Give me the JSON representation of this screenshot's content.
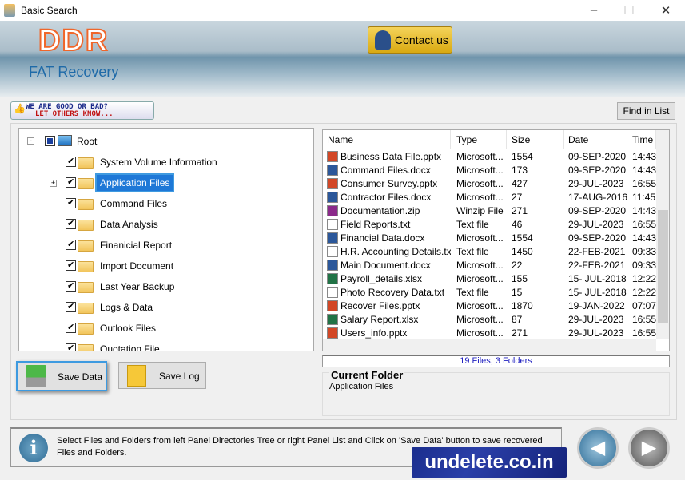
{
  "window": {
    "title": "Basic Search"
  },
  "banner": {
    "logo": "DDR",
    "product": "FAT Recovery",
    "contact_label": "Contact us"
  },
  "rating": {
    "line1": "WE ARE GOOD OR BAD?",
    "line2": "LET OTHERS KNOW..."
  },
  "find_label": "Find in List",
  "tree": {
    "root": "Root",
    "items": [
      {
        "label": "System Volume Information"
      },
      {
        "label": "Application Files",
        "selected": true,
        "expandable": true
      },
      {
        "label": "Command Files"
      },
      {
        "label": "Data Analysis"
      },
      {
        "label": "Finanicial Report"
      },
      {
        "label": "Import Document"
      },
      {
        "label": "Last Year Backup"
      },
      {
        "label": "Logs & Data"
      },
      {
        "label": "Outlook Files"
      },
      {
        "label": "Quotation File"
      }
    ]
  },
  "list": {
    "columns": [
      "Name",
      "Type",
      "Size",
      "Date",
      "Time"
    ],
    "rows": [
      {
        "icon": "pptx",
        "name": "Business Data File.pptx",
        "type": "Microsoft...",
        "size": "1554",
        "date": "09-SEP-2020",
        "time": "14:43"
      },
      {
        "icon": "docx",
        "name": "Command Files.docx",
        "type": "Microsoft...",
        "size": "173",
        "date": "09-SEP-2020",
        "time": "14:43"
      },
      {
        "icon": "pptx",
        "name": "Consumer Survey.pptx",
        "type": "Microsoft...",
        "size": "427",
        "date": "29-JUL-2023",
        "time": "16:55"
      },
      {
        "icon": "docx",
        "name": "Contractor Files.docx",
        "type": "Microsoft...",
        "size": "27",
        "date": "17-AUG-2016",
        "time": "11:45"
      },
      {
        "icon": "zip",
        "name": "Documentation.zip",
        "type": "Winzip File",
        "size": "271",
        "date": "09-SEP-2020",
        "time": "14:43"
      },
      {
        "icon": "txt",
        "name": "Field Reports.txt",
        "type": "Text file",
        "size": "46",
        "date": "29-JUL-2023",
        "time": "16:55"
      },
      {
        "icon": "docx",
        "name": "Financial Data.docx",
        "type": "Microsoft...",
        "size": "1554",
        "date": "09-SEP-2020",
        "time": "14:43"
      },
      {
        "icon": "txt",
        "name": "H.R. Accounting Details.txt",
        "type": "Text file",
        "size": "1450",
        "date": "22-FEB-2021",
        "time": "09:33"
      },
      {
        "icon": "docx",
        "name": "Main Document.docx",
        "type": "Microsoft...",
        "size": "22",
        "date": "22-FEB-2021",
        "time": "09:33"
      },
      {
        "icon": "xlsx",
        "name": "Payroll_details.xlsx",
        "type": "Microsoft...",
        "size": "155",
        "date": "15- JUL-2018",
        "time": "12:22"
      },
      {
        "icon": "txt",
        "name": "Photo Recovery Data.txt",
        "type": "Text file",
        "size": "15",
        "date": "15- JUL-2018",
        "time": "12:22"
      },
      {
        "icon": "pptx",
        "name": "Recover Files.pptx",
        "type": "Microsoft...",
        "size": "1870",
        "date": "19-JAN-2022",
        "time": "07:07"
      },
      {
        "icon": "xlsx",
        "name": "Salary Report.xlsx",
        "type": "Microsoft...",
        "size": "87",
        "date": "29-JUL-2023",
        "time": "16:55"
      },
      {
        "icon": "pptx",
        "name": "Users_info.pptx",
        "type": "Microsoft...",
        "size": "271",
        "date": "29-JUL-2023",
        "time": "16:55"
      }
    ]
  },
  "status": "19 Files, 3 Folders",
  "current_folder": {
    "heading": "Current Folder",
    "value": "Application Files"
  },
  "buttons": {
    "save_data": "Save Data",
    "save_log": "Save Log"
  },
  "info_text": "Select Files and Folders from left Panel Directories Tree or right Panel List and Click on 'Save Data' button to save recovered Files and Folders.",
  "watermark": "undelete.co.in",
  "icon_colors": {
    "pptx": "#d24726",
    "docx": "#2b579a",
    "xlsx": "#217346",
    "zip": "#8b2a8a",
    "txt": "#ffffff"
  }
}
